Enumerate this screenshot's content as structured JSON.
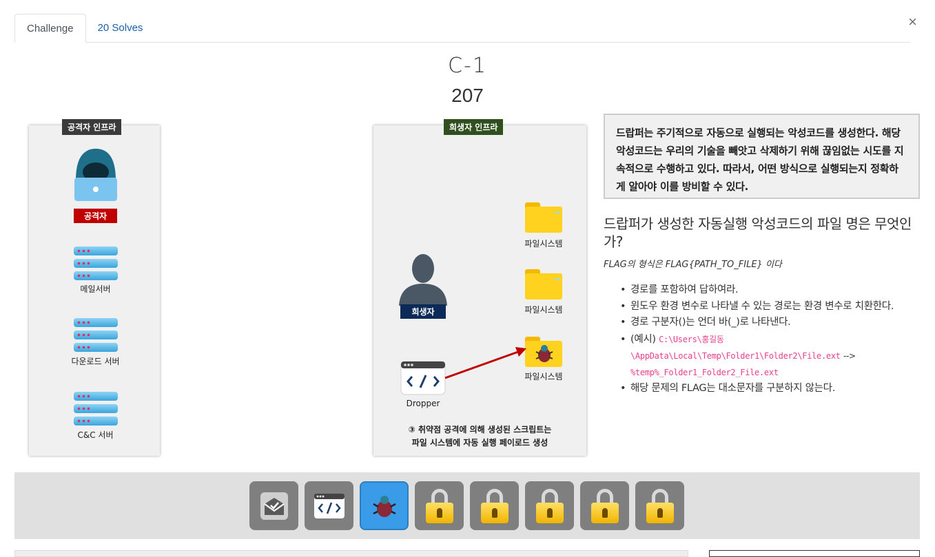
{
  "tabs": [
    {
      "label": "Challenge"
    },
    {
      "label": "20 Solves"
    }
  ],
  "close_glyph": "×",
  "challenge": {
    "name": "C-1",
    "value": "207"
  },
  "diagram": {
    "attacker_panel_title": "공격자 인프라",
    "victim_panel_title": "희생자 인프라",
    "attacker_label": "공격자",
    "mail_server_label": "메일서버",
    "download_server_label": "다운로드 서버",
    "cc_server_label": "C&C 서버",
    "victim_label": "희생자",
    "filesystem_label": "파일시스템",
    "dropper_label": "Dropper",
    "caption_line1": "③ 취약점 공격에 의해 생성된 스크립트는",
    "caption_line2": "파일 시스템에 자동 실행 페이로드 생성",
    "colors": {
      "attacker_tag": "#3b3b3b",
      "victim_tag": "#2f4f1f",
      "attacker_badge": "#c00000",
      "victim_badge": "#0b2a57",
      "arrow": "#c00000"
    }
  },
  "info_box": "드랍퍼는 주기적으로 자동으로 실행되는 악성코드를 생성한다. 해당 악성코드는 우리의 기술을 빼앗고 삭제하기 위해 끊임없는 시도를 지속적으로 수행하고 있다. 따라서, 어떤 방식으로 실행되는지 정확하게 알아야 이를 방비할 수 있다.",
  "question": "드랍퍼가 생성한 자동실행 악성코드의 파일 명은 무엇인가?",
  "flag_format": "FLAG의 형식은 FLAG{PATH_TO_FILE} 이다",
  "rules": {
    "r1": "경로를 포함하여 답하여라.",
    "r2": "윈도우 환경 변수로 나타낼 수 있는 경로는 환경 변수로 치환한다.",
    "r3": "경로 구분자()는 언더 바(_)로 나타낸다.",
    "r4_prefix": "(예시) ",
    "r4_code1": "C:\\Users\\홍길동\\AppData\\Local\\Temp\\Folder1\\Folder2\\File.ext",
    "r4_arrow": "-->",
    "r4_code2": "%temp%_Folder1_Folder2_File.ext",
    "r5": "해당 문제의 FLAG는 대소문자를 구분하지 않는다."
  },
  "icon_bar": {
    "items": [
      {
        "icon": "mail-icon",
        "state": "done"
      },
      {
        "icon": "code-window-icon",
        "state": "done"
      },
      {
        "icon": "malware-bug-icon",
        "state": "active"
      },
      {
        "icon": "lock-icon",
        "state": "locked"
      },
      {
        "icon": "lock-icon",
        "state": "locked"
      },
      {
        "icon": "lock-icon",
        "state": "locked"
      },
      {
        "icon": "lock-icon",
        "state": "locked"
      },
      {
        "icon": "lock-icon",
        "state": "locked"
      }
    ]
  }
}
